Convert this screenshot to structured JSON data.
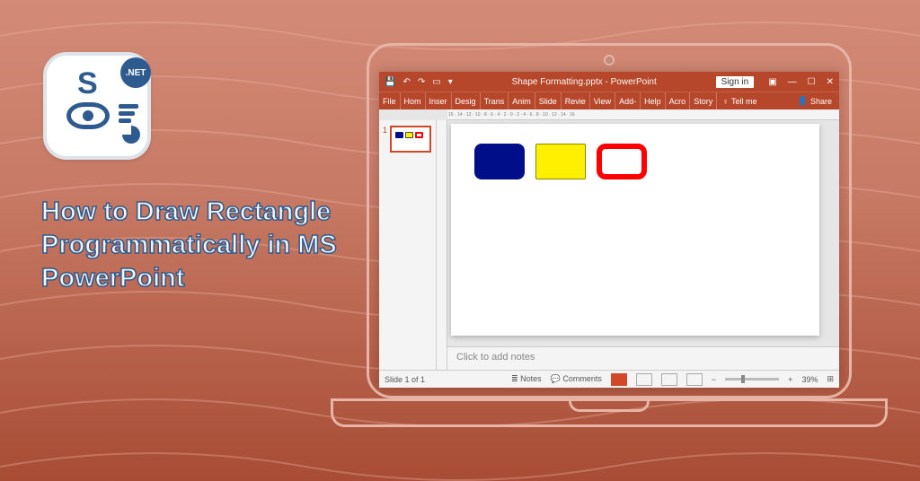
{
  "logo": {
    "letter": "S",
    "badge": ".NET"
  },
  "headline": "How to Draw Rectangle Programmatically in MS PowerPoint",
  "pp": {
    "titlebar": {
      "title": "Shape Formatting.pptx  -  PowerPoint",
      "signin": "Sign in"
    },
    "ribbon": {
      "tabs": [
        "File",
        "Hom",
        "Inser",
        "Desig",
        "Trans",
        "Anim",
        "Slide",
        "Revie",
        "View",
        "Add-",
        "Help",
        "Acro",
        "Story"
      ],
      "tellme": "Tell me",
      "share": "Share"
    },
    "ruler_h": "16 · 14 · 12 · 10 · 8 · 6 · 4 · 2 · 0 · 2 · 4 · 6 · 8 · 10 · 12 · 14 · 16",
    "thumb_num": "1",
    "notes_placeholder": "Click to add notes",
    "status": {
      "slide": "Slide 1 of 1",
      "notes": "Notes",
      "comments": "Comments",
      "zoom": "39%",
      "plus": "+",
      "minus": "−"
    }
  }
}
